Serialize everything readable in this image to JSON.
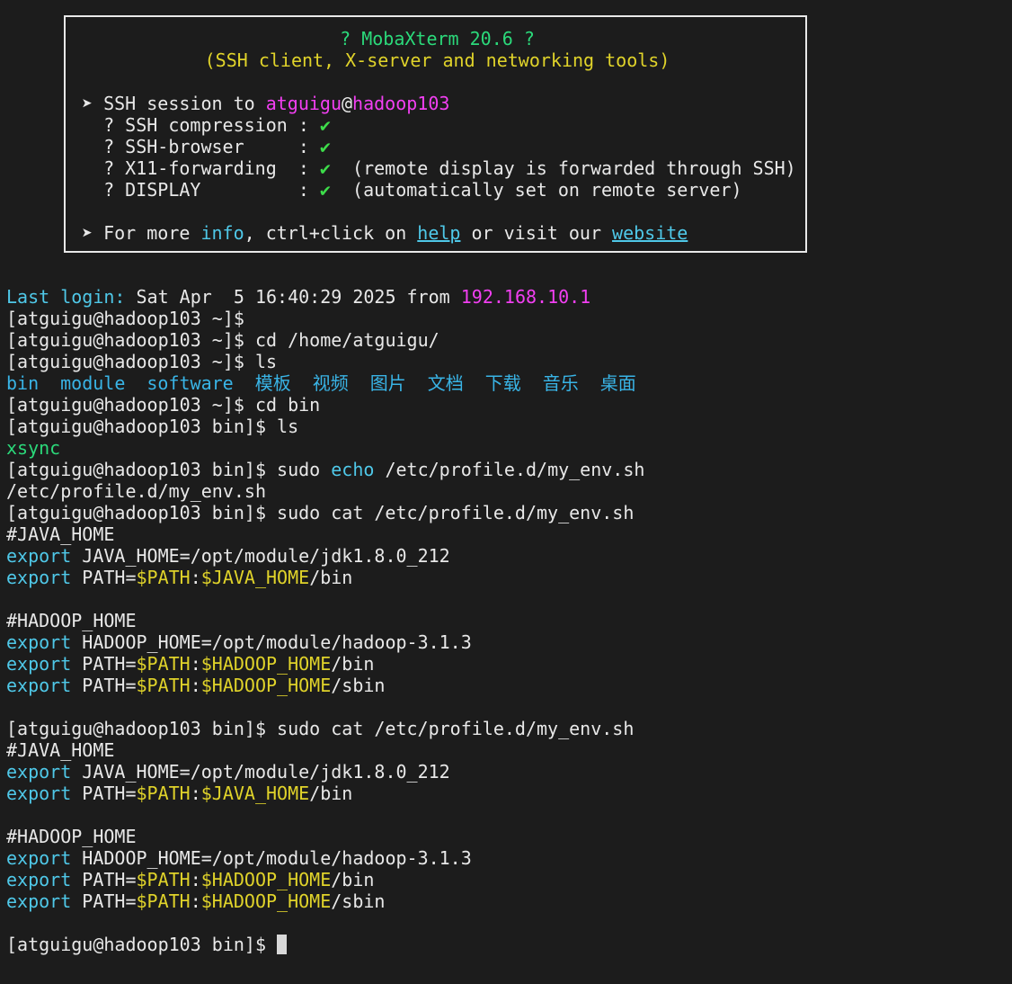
{
  "banner": {
    "title": "? MobaXterm 20.6 ?",
    "subtitle": "(SSH client, X-server and networking tools)",
    "session_prefix": "➤ SSH session to ",
    "session_user": "atguigu",
    "session_at": "@",
    "session_host": "hadoop103",
    "features": [
      {
        "label": "  ? SSH compression : ",
        "check": "✔",
        "note": ""
      },
      {
        "label": "  ? SSH-browser     : ",
        "check": "✔",
        "note": ""
      },
      {
        "label": "  ? X11-forwarding  : ",
        "check": "✔",
        "note": "  (remote display is forwarded through SSH)"
      },
      {
        "label": "  ? DISPLAY         : ",
        "check": "✔",
        "note": "  (automatically set on remote server)"
      }
    ],
    "more_prefix": "➤ For more ",
    "more_info": "info",
    "more_mid": ", ctrl+click on ",
    "more_help": "help",
    "more_or": " or visit our ",
    "more_website": "website"
  },
  "terminal": {
    "last_login_label": "Last login:",
    "last_login_time": " Sat Apr  5 16:40:29 2025 from ",
    "last_login_ip": "192.168.10.1",
    "prompt_home": "[atguigu@hadoop103 ~]$",
    "prompt_bin": "[atguigu@hadoop103 bin]$",
    "cmd_cd_home": " cd /home/atguigu/",
    "cmd_ls": " ls",
    "ls_dirs": [
      "bin",
      "module",
      "software",
      "模板",
      "视频",
      "图片",
      "文档",
      "下载",
      "音乐",
      "桌面"
    ],
    "cmd_cd_bin": " cd bin",
    "ls_bin_output": "xsync",
    "cmd_sudo": " sudo ",
    "cmd_echo": "echo",
    "cmd_echo_arg": " /etc/profile.d/my_env.sh",
    "echo_output": "/etc/profile.d/my_env.sh",
    "cmd_cat": " sudo cat /etc/profile.d/my_env.sh",
    "file": {
      "java_comment": "#JAVA_HOME",
      "export_kw": "export",
      "java_home": " JAVA_HOME=/opt/module/jdk1.8.0_212",
      "path_eq": " PATH=",
      "var_path": "$PATH",
      "colon": ":",
      "var_java_home": "$JAVA_HOME",
      "bin_suffix": "/bin",
      "hadoop_comment": "#HADOOP_HOME",
      "hadoop_home": " HADOOP_HOME=/opt/module/hadoop-3.1.3",
      "var_hadoop_home": "$HADOOP_HOME",
      "sbin_suffix": "/sbin"
    },
    "final_prompt": "[atguigu@hadoop103 bin]$ "
  }
}
